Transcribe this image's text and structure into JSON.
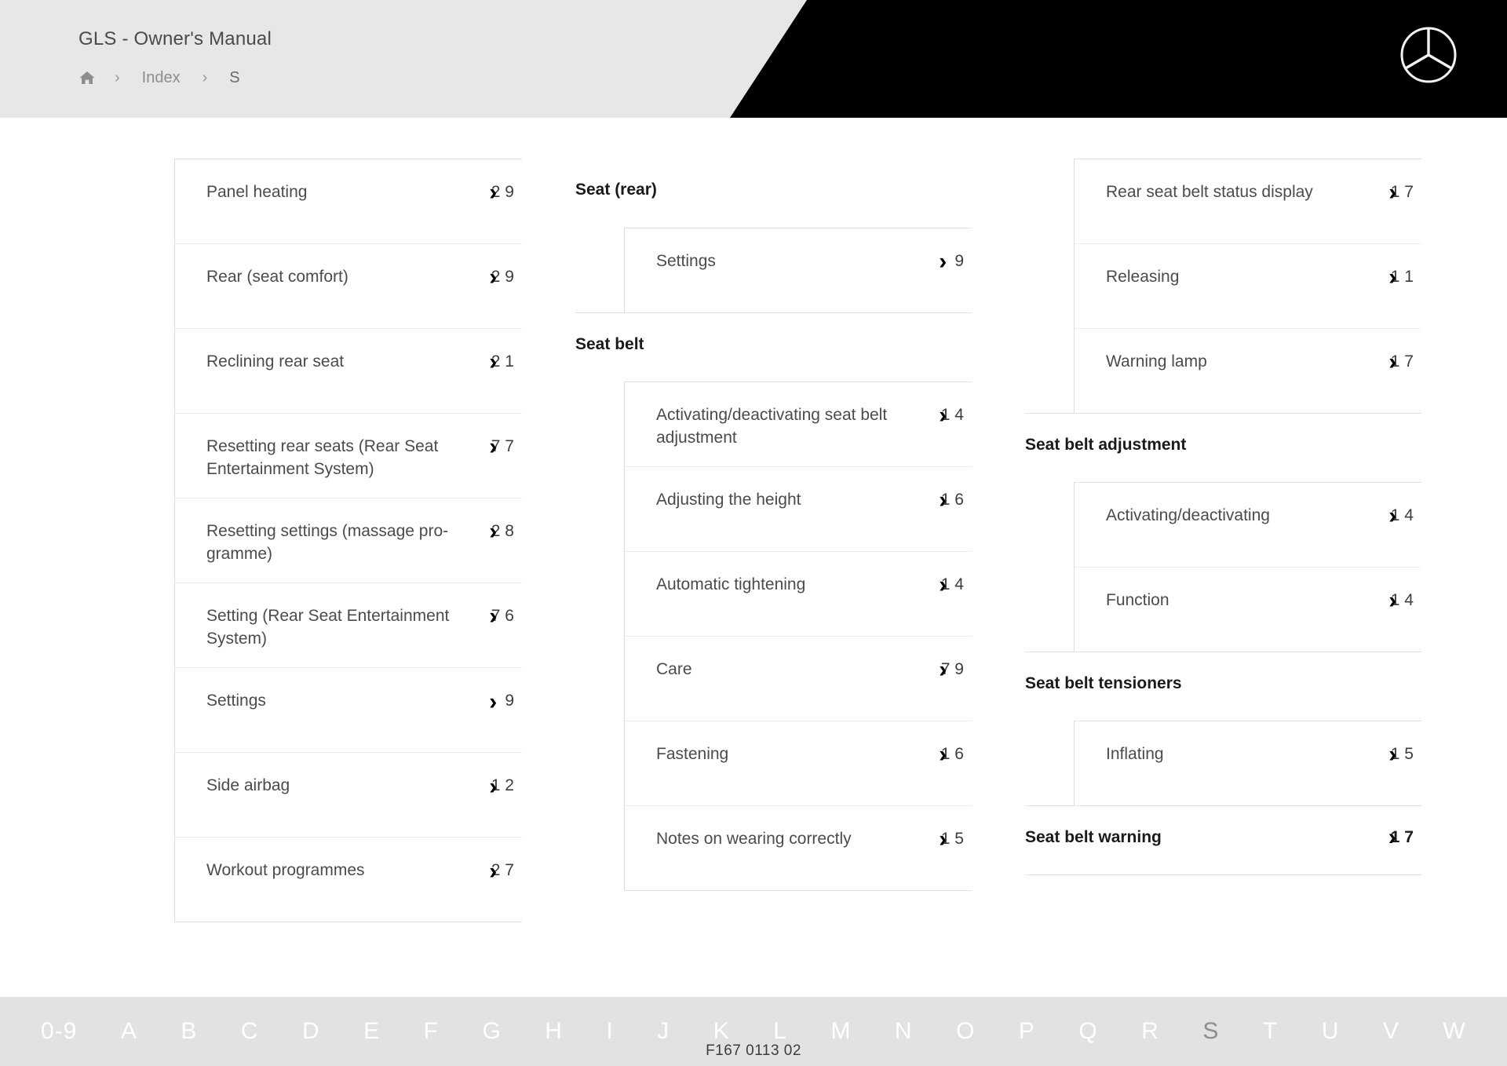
{
  "header": {
    "title": "GLS - Owner's Manual",
    "breadcrumb": {
      "home_icon": "home-icon",
      "separator": "›",
      "items": [
        "Index",
        "S"
      ]
    },
    "logo": "mercedes-benz-star-logo"
  },
  "columns": [
    {
      "entries": [
        {
          "label": "Panel heating",
          "page": "2 9",
          "chevron": "›",
          "level": "sub",
          "first": true
        },
        {
          "label": "Rear (seat comfort)",
          "page": "2 9",
          "chevron": "›",
          "level": "sub"
        },
        {
          "label": "Reclining rear seat",
          "page": "2 1",
          "chevron": "›",
          "level": "sub"
        },
        {
          "label": "Resetting rear seats (Rear Seat Entertainment System)",
          "page": "7 7",
          "chevron": "›",
          "level": "sub"
        },
        {
          "label": "Resetting settings (massage pro-gramme)",
          "page": "2 8",
          "chevron": "›",
          "level": "sub"
        },
        {
          "label": "Setting (Rear Seat Entertainment System)",
          "page": "7 6",
          "chevron": "›",
          "level": "sub"
        },
        {
          "label": "Settings",
          "page": "9 ",
          "chevron": "›",
          "level": "sub"
        },
        {
          "label": "Side airbag",
          "page": "1 2",
          "chevron": "›",
          "level": "sub"
        },
        {
          "label": "Workout programmes",
          "page": "2 7",
          "chevron": "›",
          "level": "sub"
        }
      ]
    },
    {
      "entries": [
        {
          "label": "Seat (rear)",
          "page": "",
          "chevron": "",
          "level": "head",
          "first": true
        },
        {
          "label": "Settings",
          "page": "9 ",
          "chevron": "›",
          "level": "sub",
          "first": true
        },
        {
          "label": "Seat belt",
          "page": "",
          "chevron": "",
          "level": "head"
        },
        {
          "label": "Activating/deactivating seat belt adjustment",
          "page": "1 4",
          "chevron": "›",
          "level": "sub",
          "first": true
        },
        {
          "label": "Adjusting the height",
          "page": "1 6",
          "chevron": "›",
          "level": "sub"
        },
        {
          "label": "Automatic tightening",
          "page": "1 4",
          "chevron": "›",
          "level": "sub"
        },
        {
          "label": "Care",
          "page": "7 9",
          "chevron": "›",
          "level": "sub"
        },
        {
          "label": "Fastening",
          "page": "1 6",
          "chevron": "›",
          "level": "sub"
        },
        {
          "label": "Notes on wearing correctly",
          "page": "1 5",
          "chevron": "›",
          "level": "sub"
        }
      ]
    },
    {
      "entries": [
        {
          "label": "Rear seat belt status display",
          "page": "1 7",
          "chevron": "›",
          "level": "sub",
          "first": true
        },
        {
          "label": "Releasing",
          "page": "1 1",
          "chevron": "›",
          "level": "sub"
        },
        {
          "label": "Warning lamp",
          "page": "1 7",
          "chevron": "›",
          "level": "sub"
        },
        {
          "label": "Seat belt adjustment",
          "page": "",
          "chevron": "",
          "level": "head"
        },
        {
          "label": "Activating/deactivating",
          "page": "1 4",
          "chevron": "›",
          "level": "sub",
          "first": true
        },
        {
          "label": "Function",
          "page": "1 4",
          "chevron": "›",
          "level": "sub"
        },
        {
          "label": "Seat belt tensioners",
          "page": "",
          "chevron": "",
          "level": "head"
        },
        {
          "label": "Inflating",
          "page": "1 5",
          "chevron": "›",
          "level": "sub",
          "first": true
        },
        {
          "label": "Seat belt warning",
          "page": "1 7",
          "chevron": "›",
          "level": "head"
        }
      ]
    }
  ],
  "alphabet_bar": {
    "letters": [
      "0-9",
      "A",
      "B",
      "C",
      "D",
      "E",
      "F",
      "G",
      "H",
      "I",
      "J",
      "K",
      "L",
      "M",
      "N",
      "O",
      "P",
      "Q",
      "R",
      "S",
      "T",
      "U",
      "V",
      "W"
    ],
    "active": "S"
  },
  "footer": {
    "code": "F167 0113 02"
  },
  "colors": {
    "header_bg": "#e7e7e7",
    "header_panel": "#000000",
    "content_bg": "#ffffff",
    "alpha_bar_bg": "#e2e2e2",
    "alpha_letter": "#ffffff",
    "alpha_active": "#8e8e8e",
    "text_primary": "#1a1a1a",
    "text_secondary": "#4b4b4b"
  }
}
